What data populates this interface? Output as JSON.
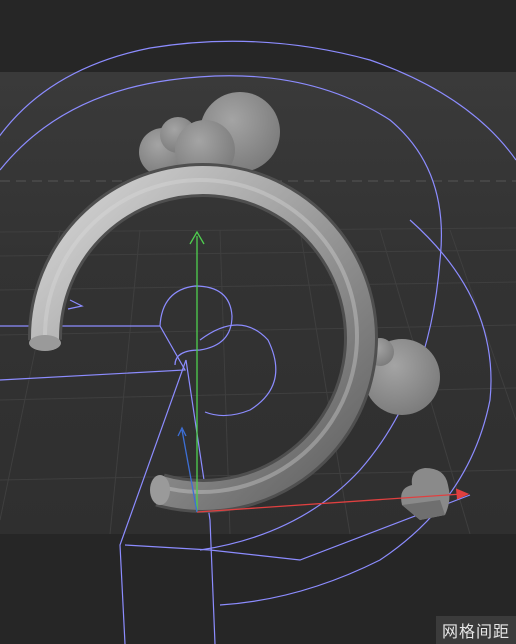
{
  "viewport": {
    "grid_spacing_label": "网格间距"
  },
  "colors": {
    "background_dark": "#262626",
    "floor": "#363636",
    "spline_wire": "#8c8cff",
    "y_axis": "#4fd04f",
    "x_axis": "#e04040",
    "z_axis": "#3d6fd6",
    "object_gray": "#8f8f8f"
  },
  "icons": {
    "torus": "torus-object",
    "cloud": "cloud-object",
    "heart": "heart-object",
    "gizmo": "axis-gizmo"
  }
}
